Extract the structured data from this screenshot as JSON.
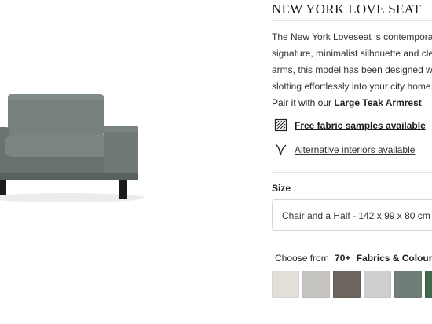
{
  "product": {
    "title": "NEW YORK LOVE SEAT",
    "image_alt": "grey-armchair-photo"
  },
  "description": {
    "lines": [
      "The New York Loveseat is contemporary a",
      "signature, minimalist silhouette and clean",
      "arms, this model has been designed with",
      "slotting effortlessly into your city home."
    ]
  },
  "pairing": {
    "prefix": "Pair it with our",
    "product": "Large Teak Armrest"
  },
  "links": {
    "fabric_samples": {
      "label": "Free fabric samples available",
      "icon": "fabric-swatch-icon"
    },
    "alternative_interiors": {
      "label": "Alternative interiors available",
      "icon": "fork-icon"
    }
  },
  "size": {
    "label": "Size",
    "selected": "Chair and a Half - 142 x 99 x 80 cm"
  },
  "fabrics": {
    "prefix": "Choose from",
    "count": "70+",
    "label": "Fabrics & Colours",
    "swatches": [
      {
        "name": "cream",
        "color": "#e2ded8"
      },
      {
        "name": "light-grey",
        "color": "#c7c5c1"
      },
      {
        "name": "taupe",
        "color": "#6b655d"
      },
      {
        "name": "pale-grey",
        "color": "#cfcfcd"
      },
      {
        "name": "grey-green",
        "color": "#6f7d79"
      },
      {
        "name": "dark-green",
        "color": "#3f6a4b"
      }
    ]
  },
  "colors": {
    "sofa_fabric": "#6e7876",
    "sofa_shadow": "#59625f",
    "legs": "#1a1a1a"
  }
}
